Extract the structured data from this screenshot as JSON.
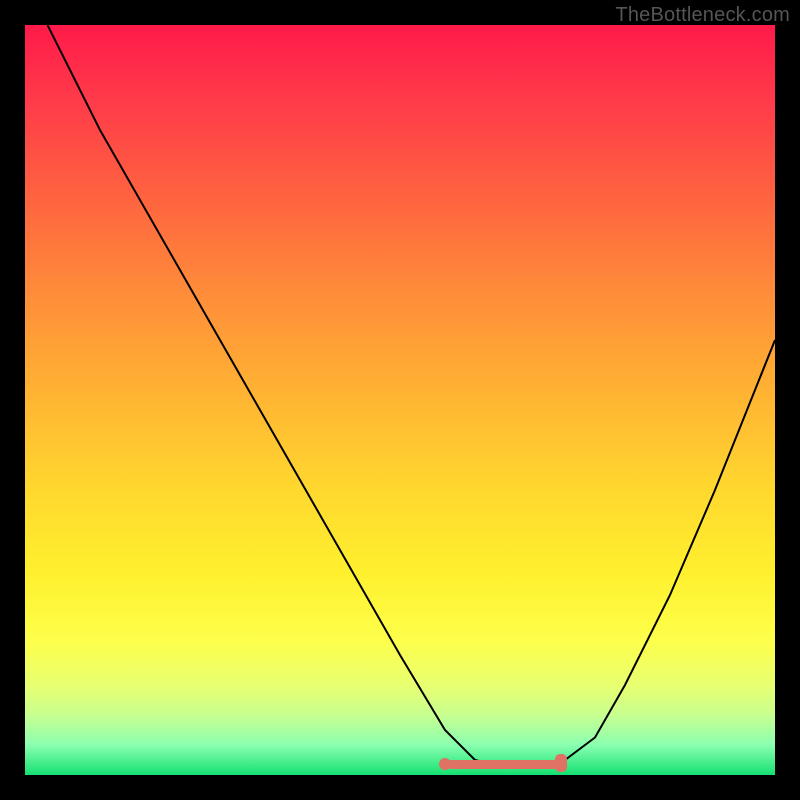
{
  "watermark": "TheBottleneck.com",
  "chart_data": {
    "type": "line",
    "title": "",
    "xlabel": "",
    "ylabel": "",
    "xlim": [
      0,
      100
    ],
    "ylim": [
      0,
      100
    ],
    "series": [
      {
        "name": "bottleneck-curve",
        "x": [
          3,
          10,
          18,
          26,
          34,
          42,
          50,
          56,
          60,
          64,
          68,
          72,
          76,
          80,
          86,
          92,
          100
        ],
        "y": [
          100,
          86,
          72,
          58,
          44,
          30,
          16,
          6,
          2,
          1,
          1,
          2,
          5,
          12,
          24,
          38,
          58
        ]
      }
    ],
    "highlight": {
      "name": "optimal-range",
      "x_start": 56,
      "x_end": 72,
      "y": 1.5
    }
  }
}
